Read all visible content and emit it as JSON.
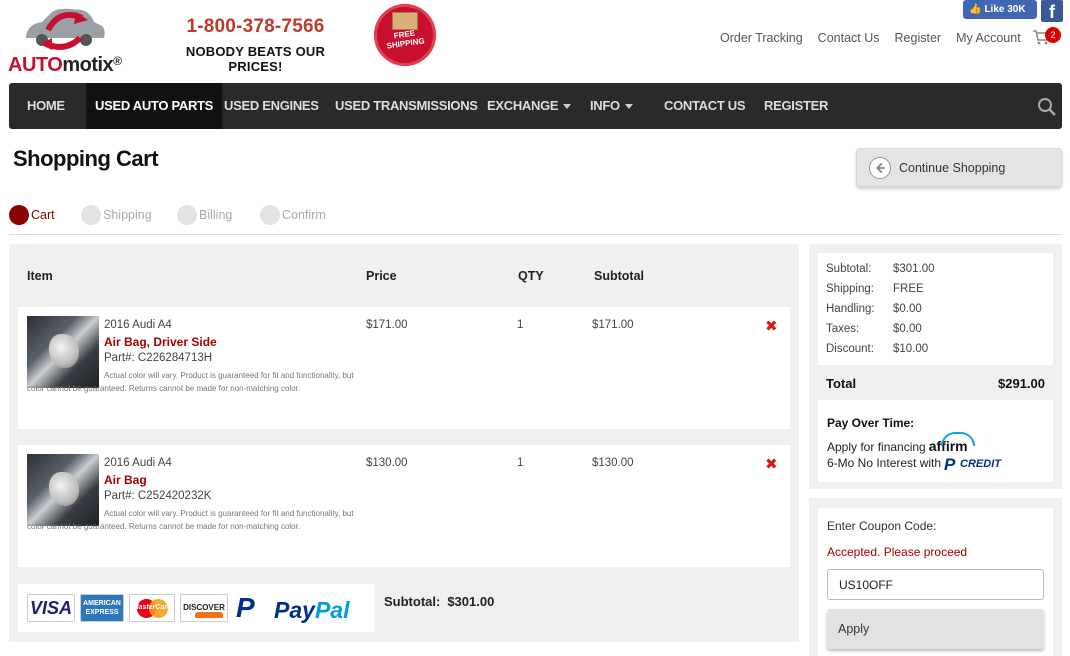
{
  "brand": {
    "logo_text_a": "AUTO",
    "logo_text_b": "motix",
    "logo_reg": "®",
    "phone": "1-800-378-7566",
    "slogan": "NOBODY BEATS OUR PRICES!",
    "badge_line1": "FREE",
    "badge_line2": "SHIPPING",
    "accent_color": "#c8102e"
  },
  "social": {
    "fb_like_label": "Like 30K",
    "fb_icon": "f"
  },
  "top_links": [
    "Order Tracking",
    "Contact Us",
    "Register",
    "My Account"
  ],
  "cart": {
    "count": "2"
  },
  "nav": {
    "items": [
      {
        "label": "HOME"
      },
      {
        "label": "USED AUTO PARTS"
      },
      {
        "label": "USED ENGINES"
      },
      {
        "label": "USED TRANSMISSIONS"
      },
      {
        "label": "EXCHANGE"
      },
      {
        "label": "INFO"
      },
      {
        "label": "CONTACT US"
      },
      {
        "label": "REGISTER"
      }
    ]
  },
  "page": {
    "title": "Shopping Cart",
    "continue_label": "Continue Shopping"
  },
  "steps": [
    "Cart",
    "Shipping",
    "Billing",
    "Confirm"
  ],
  "table": {
    "headers": [
      "Item",
      "Price",
      "QTY",
      "Subtotal"
    ],
    "items": [
      {
        "model": "2016 Audi A4",
        "name": "Air Bag, Driver Side",
        "part": "Part#: C226284713H",
        "note": "Actual color will vary. Product is guaranteed for fit and functionality, but color cannot be guaranteed. Returns cannot be made for non-matching color.",
        "price": "$171.00",
        "qty": "1",
        "subtotal": "$171.00",
        "delete": "✖"
      },
      {
        "model": "2016 Audi A4",
        "name": "Air Bag",
        "part": "Part#: C252420232K",
        "note": "Actual color will vary. Product is guaranteed for fit and functionality, but color cannot be guaranteed. Returns cannot be made for non-matching color.",
        "price": "$130.00",
        "qty": "1",
        "subtotal": "$130.00",
        "delete": "✖"
      }
    ],
    "payment_logos": {
      "visa": "VISA",
      "amex": "AMERICAN EXPRESS",
      "mc": "MasterCard",
      "discover": "DISCOVER",
      "paypal_a": "Pay",
      "paypal_b": "Pal"
    },
    "subtotal_label": "Subtotal:",
    "subtotal_value": "$301.00"
  },
  "summary": {
    "rows": [
      {
        "label": "Subtotal:",
        "value": "$301.00"
      },
      {
        "label": "Shipping:",
        "value": "FREE"
      },
      {
        "label": "Handling:",
        "value": "$0.00"
      },
      {
        "label": "Taxes:",
        "value": "$0.00"
      },
      {
        "label": "Discount:",
        "value": "$10.00"
      }
    ],
    "total_label": "Total",
    "total_value": "$291.00",
    "pay_over_time": "Pay Over Time:",
    "financing_text": "Apply for financing",
    "affirm": "affirm",
    "interest_text": "6-Mo No Interest with",
    "paypal_credit": "CREDIT"
  },
  "coupon": {
    "label": "Enter Coupon Code:",
    "status": "Accepted. Please proceed",
    "value": "US10OFF",
    "apply_label": "Apply"
  }
}
